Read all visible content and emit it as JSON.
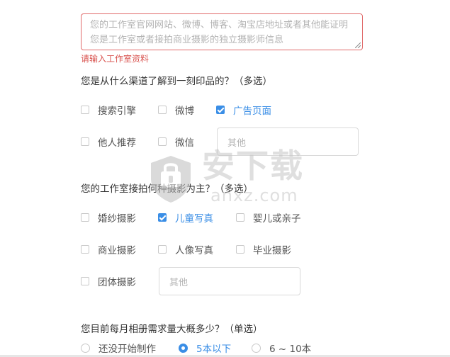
{
  "studio_info": {
    "placeholder": "您的工作室官网网站、微博、博客、淘宝店地址或者其他能证明您是工作室或者接拍商业摄影的独立摄影师信息",
    "error": "请输入工作室资料"
  },
  "q1": {
    "title": "您是从什么渠道了解到一刻印品的？（多选）",
    "options": [
      {
        "label": "搜索引擎",
        "checked": false
      },
      {
        "label": "微博",
        "checked": false
      },
      {
        "label": "广告页面",
        "checked": true
      },
      {
        "label": "他人推荐",
        "checked": false
      },
      {
        "label": "微信",
        "checked": false
      }
    ],
    "other_placeholder": "其他"
  },
  "q2": {
    "title": "您的工作室接拍何种摄影为主？（多选）",
    "options": [
      {
        "label": "婚纱摄影",
        "checked": false
      },
      {
        "label": "儿童写真",
        "checked": true
      },
      {
        "label": "婴儿或亲子",
        "checked": false
      },
      {
        "label": "商业摄影",
        "checked": false
      },
      {
        "label": "人像写真",
        "checked": false
      },
      {
        "label": "毕业摄影",
        "checked": false
      },
      {
        "label": "团体摄影",
        "checked": false
      }
    ],
    "other_placeholder": "其他"
  },
  "q3": {
    "title": "您目前每月相册需求量大概多少？（单选）",
    "options": [
      {
        "label": "还没开始制作",
        "checked": false
      },
      {
        "label": "5本以下",
        "checked": true
      },
      {
        "label": "6 ~ 10本",
        "checked": false
      }
    ]
  },
  "watermark": {
    "text_cn": "安下载",
    "text_en": "anxz.com",
    "icon": "shield-icon"
  },
  "colors": {
    "accent": "#3a8ee6",
    "error": "#d9534f",
    "error_border": "#e06a6a"
  }
}
